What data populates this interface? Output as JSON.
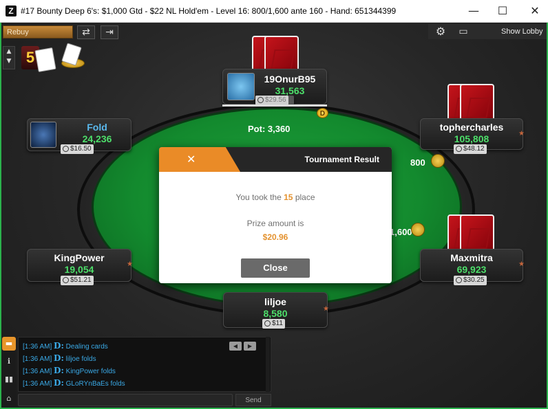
{
  "window": {
    "app_icon": "Z",
    "title": "#17 Bounty Deep 6's: $1,000 Gtd - $22 NL Hold'em - Level 16: 800/1,600 ante 160 - Hand: 651344399",
    "minimize": "—",
    "maximize": "☐",
    "close": "✕"
  },
  "toolbar": {
    "rebuy_label": "Rebuy",
    "refresh_icon": "⇄",
    "exit_icon": "⇥",
    "show_lobby_label": "Show Lobby",
    "settings_icon": "⚙",
    "view_icon": "▭",
    "side_up": "▲",
    "side_down": "▼"
  },
  "badges": {
    "five_label": "5"
  },
  "table": {
    "pot_label": "Pot: 3,360",
    "dealer_label": "D"
  },
  "seats": {
    "top": {
      "name": "19OnurB95",
      "stack": "31,563",
      "bounty": "$29.56"
    },
    "left": {
      "name": "Fold",
      "stack": "24,236",
      "bounty": "$16.50"
    },
    "right": {
      "name": "tophercharles",
      "stack": "105,808",
      "bounty": "$48.12"
    },
    "bottom_left": {
      "name": "KingPower",
      "stack": "19,054",
      "bounty": "$51.21"
    },
    "bottom_right": {
      "name": "Maxmitra",
      "stack": "69,923",
      "bounty": "$30.25"
    },
    "bottom": {
      "name": "liljoe",
      "stack": "8,580",
      "bounty": "$11"
    }
  },
  "bets": {
    "right_bet": "800",
    "right2_bet": "1,600"
  },
  "modal": {
    "close_x": "✕",
    "title": "Tournament Result",
    "line1_prefix": "You took the",
    "place": "15",
    "line1_suffix": "place",
    "prize_label": "Prize amount is",
    "prize_value": "$20.96",
    "close_button": "Close"
  },
  "chat": {
    "lines": [
      {
        "time": "[1:36 AM]",
        "prefix": "D:",
        "text": "Dealing cards"
      },
      {
        "time": "[1:36 AM]",
        "prefix": "D:",
        "text": "liljoe  folds"
      },
      {
        "time": "[1:36 AM]",
        "prefix": "D:",
        "text": "KingPower  folds"
      },
      {
        "time": "[1:36 AM]",
        "prefix": "D:",
        "text": "GLoRYnBaEs  folds"
      }
    ],
    "prev": "◀",
    "next": "▶",
    "send_label": "Send",
    "tab_icons": [
      "▬",
      "ℹ",
      "▮▮",
      "⌂"
    ]
  }
}
